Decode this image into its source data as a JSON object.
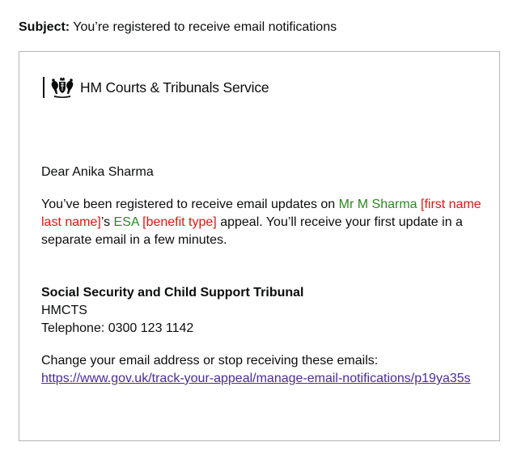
{
  "subject": {
    "label": "Subject:",
    "text": "You’re registered to receive email notifications"
  },
  "logo": {
    "icon": "royal-crest-icon",
    "text": "HM Courts & Tribunals Service"
  },
  "greeting": "Dear Anika Sharma",
  "message": {
    "intro": "You’ve been registered to receive email updates on ",
    "appellant_name": "Mr M Sharma",
    "appellant_placeholder": "[first name last name]",
    "possessive": "’s ",
    "benefit": "ESA",
    "benefit_placeholder": "[benefit type]",
    "outro": " appeal. You’ll receive your first update in a separate email in a few minutes."
  },
  "signature": {
    "title": "Social Security and Child Support Tribunal",
    "org": "HMCTS",
    "phone": "Telephone: 0300 123 1142"
  },
  "footer": {
    "text": "Change your email address or stop receiving these emails:",
    "link": "https://www.gov.uk/track-your-appeal/manage-email-notifications/p19ya35s"
  },
  "colors": {
    "green_text": "#2b8a1e",
    "red_text": "#e4130e",
    "link": "#4c2c92"
  }
}
